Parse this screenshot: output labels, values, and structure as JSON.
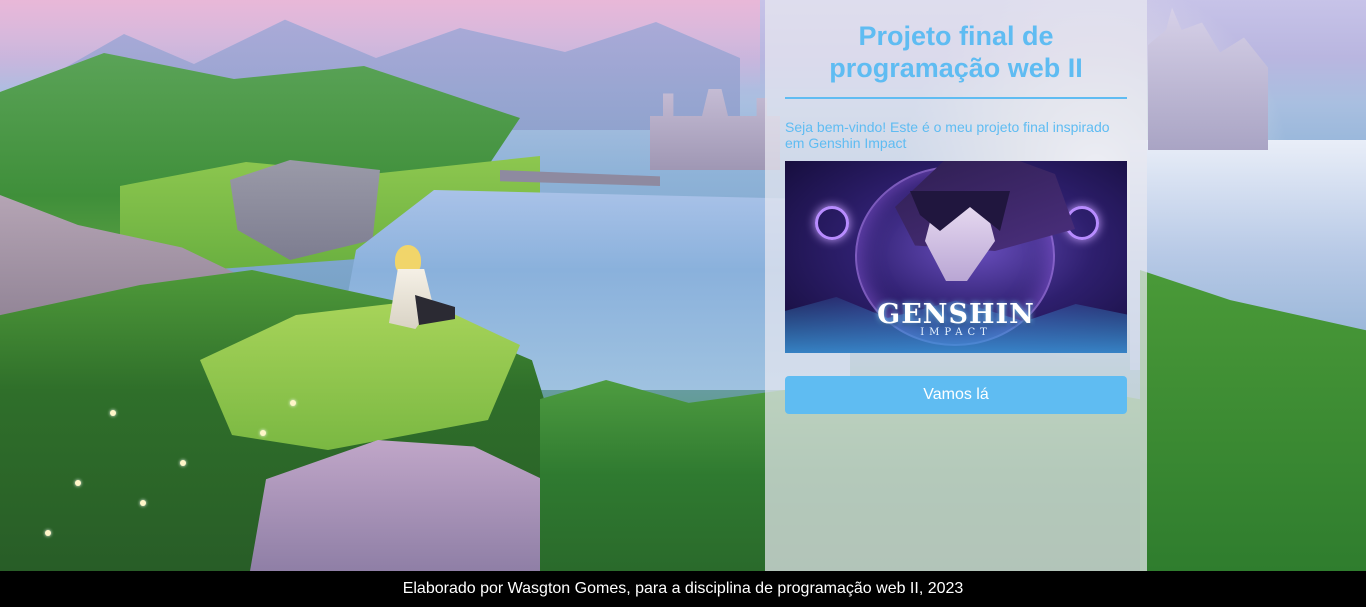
{
  "page": {
    "title": "Projeto final de programação web II",
    "welcome_text": "Seja bem-vindo! Este é o meu projeto final inspirado em Genshin Impact",
    "hero_logo_main": "GENSHIN",
    "hero_logo_sub": "IMPACT",
    "cta_label": "Vamos lá"
  },
  "footer": {
    "text": "Elaborado por Wasgton Gomes, para a disciplina de programação web II, 2023"
  },
  "colors": {
    "accent": "#5fbcf2",
    "panel_bg": "rgba(232,232,240,0.72)",
    "footer_bg": "#000000"
  }
}
